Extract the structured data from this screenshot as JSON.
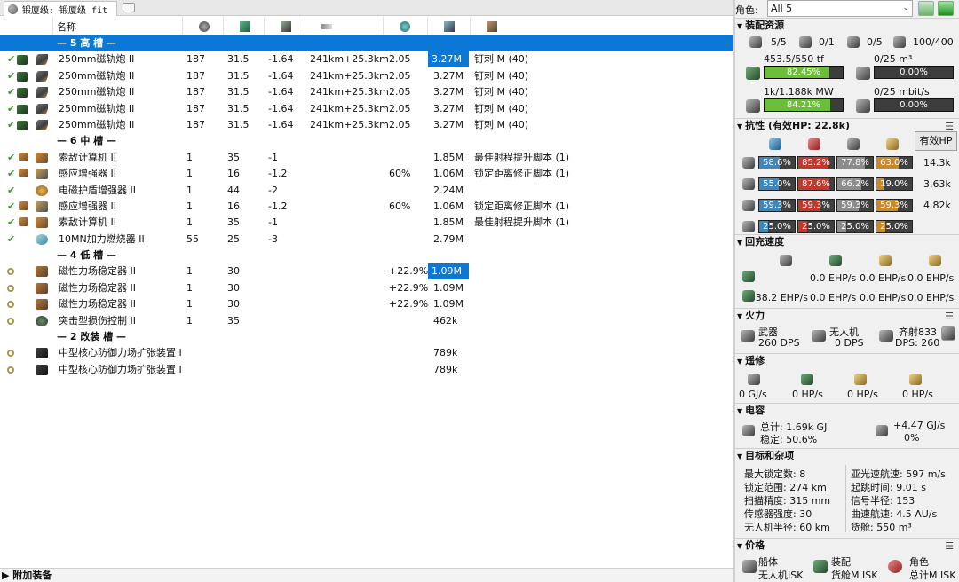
{
  "tab": {
    "title": "锻厦级: 锻厦级 fit"
  },
  "columns": {
    "name": "名称"
  },
  "racks": {
    "high": "— 5 高 槽 —",
    "mid": "— 6 中 槽 —",
    "low": "— 4 低 槽 —",
    "rig": "— 2 改装 槽 —"
  },
  "high_rows": [
    {
      "name": "250mm磁轨炮 II",
      "v1": "187",
      "v2": "31.5",
      "v3": "-1.64",
      "v4": "241km+25.3km",
      "v5": "2.05",
      "v6": "3.27M",
      "ammo": "钉刺 M (40)"
    },
    {
      "name": "250mm磁轨炮 II",
      "v1": "187",
      "v2": "31.5",
      "v3": "-1.64",
      "v4": "241km+25.3km",
      "v5": "2.05",
      "v6": "3.27M",
      "ammo": "钉刺 M (40)"
    },
    {
      "name": "250mm磁轨炮 II",
      "v1": "187",
      "v2": "31.5",
      "v3": "-1.64",
      "v4": "241km+25.3km",
      "v5": "2.05",
      "v6": "3.27M",
      "ammo": "钉刺 M (40)"
    },
    {
      "name": "250mm磁轨炮 II",
      "v1": "187",
      "v2": "31.5",
      "v3": "-1.64",
      "v4": "241km+25.3km",
      "v5": "2.05",
      "v6": "3.27M",
      "ammo": "钉刺 M (40)"
    },
    {
      "name": "250mm磁轨炮 II",
      "v1": "187",
      "v2": "31.5",
      "v3": "-1.64",
      "v4": "241km+25.3km",
      "v5": "2.05",
      "v6": "3.27M",
      "ammo": "钉刺 M (40)"
    }
  ],
  "mid_rows": [
    {
      "name": "索敌计算机 II",
      "v1": "1",
      "v2": "35",
      "v3": "-1",
      "v4": "",
      "v5": "",
      "v6": "1.85M",
      "ammo": "最佳射程提升脚本 (1)"
    },
    {
      "name": "感应增强器 II",
      "v1": "1",
      "v2": "16",
      "v3": "-1.2",
      "v4": "",
      "v5": "60%",
      "v6": "1.06M",
      "ammo": "锁定距离修正脚本 (1)"
    },
    {
      "name": "电磁护盾增强器 II",
      "v1": "1",
      "v2": "44",
      "v3": "-2",
      "v4": "",
      "v5": "",
      "v6": "2.24M",
      "ammo": ""
    },
    {
      "name": "感应增强器 II",
      "v1": "1",
      "v2": "16",
      "v3": "-1.2",
      "v4": "",
      "v5": "60%",
      "v6": "1.06M",
      "ammo": "锁定距离修正脚本 (1)"
    },
    {
      "name": "索敌计算机 II",
      "v1": "1",
      "v2": "35",
      "v3": "-1",
      "v4": "",
      "v5": "",
      "v6": "1.85M",
      "ammo": "最佳射程提升脚本 (1)"
    },
    {
      "name": "10MN加力燃烧器 II",
      "v1": "55",
      "v2": "25",
      "v3": "-3",
      "v4": "",
      "v5": "",
      "v6": "2.79M",
      "ammo": ""
    }
  ],
  "low_rows": [
    {
      "name": "磁性力场稳定器 II",
      "v1": "1",
      "v2": "30",
      "v3": "",
      "v4": "",
      "v5": "+22.9%",
      "v6": "1.09M",
      "ammo": ""
    },
    {
      "name": "磁性力场稳定器 II",
      "v1": "1",
      "v2": "30",
      "v3": "",
      "v4": "",
      "v5": "+22.9%",
      "v6": "1.09M",
      "ammo": ""
    },
    {
      "name": "磁性力场稳定器 II",
      "v1": "1",
      "v2": "30",
      "v3": "",
      "v4": "",
      "v5": "+22.9%",
      "v6": "1.09M",
      "ammo": ""
    },
    {
      "name": "突击型损伤控制 II",
      "v1": "1",
      "v2": "35",
      "v3": "",
      "v4": "",
      "v5": "",
      "v6": "462k",
      "ammo": ""
    }
  ],
  "rig_rows": [
    {
      "name": "中型核心防御力场扩张装置 I",
      "v6": "789k"
    },
    {
      "name": "中型核心防御力场扩张装置 I",
      "v6": "789k"
    }
  ],
  "addon": "附加装备",
  "character": {
    "label": "角色:",
    "value": "All 5"
  },
  "resources": {
    "title": "装配资源",
    "turret": "5/5",
    "launcher": "0/1",
    "drone": "0/5",
    "calib": "100/400",
    "cpu_label": "453.5/550 tf",
    "cpu_pct": "82.45%",
    "cpu_fill": 0.8245,
    "pg_label": "1k/1.188k MW",
    "pg_pct": "84.21%",
    "pg_fill": 0.8421,
    "bay_label": "0/25 m³",
    "bay_pct": "0.00%",
    "bw_label": "0/25 mbit/s",
    "bw_pct": "0.00%"
  },
  "resist": {
    "title": "抗性 (有效HP: 22.8k)",
    "btn": "有效HP",
    "rows": [
      {
        "em": "58.6%",
        "th": "85.2%",
        "ki": "77.8%",
        "ex": "63.0%",
        "hp": "14.3k",
        "emv": 0.586,
        "thv": 0.852,
        "kiv": 0.778,
        "exv": 0.63
      },
      {
        "em": "55.0%",
        "th": "87.6%",
        "ki": "66.2%",
        "ex": "19.0%",
        "hp": "3.63k",
        "emv": 0.55,
        "thv": 0.876,
        "kiv": 0.662,
        "exv": 0.19
      },
      {
        "em": "59.3%",
        "th": "59.3%",
        "ki": "59.3%",
        "ex": "59.3%",
        "hp": "4.82k",
        "emv": 0.593,
        "thv": 0.593,
        "kiv": 0.593,
        "exv": 0.593
      },
      {
        "em": "25.0%",
        "th": "25.0%",
        "ki": "25.0%",
        "ex": "25.0%",
        "hp": "",
        "emv": 0.25,
        "thv": 0.25,
        "kiv": 0.25,
        "exv": 0.25
      }
    ]
  },
  "recharge": {
    "title": "回充速度",
    "r1": [
      "",
      "0.0 EHP/s",
      "0.0 EHP/s",
      "0.0 EHP/s"
    ],
    "r2": [
      "38.2 EHP/s",
      "0.0 EHP/s",
      "0.0 EHP/s",
      "0.0 EHP/s"
    ]
  },
  "firepower": {
    "title": "火力",
    "weapon": "武器",
    "weapon_dps": "260 DPS",
    "drone": "无人机",
    "drone_dps": "0 DPS",
    "volley": "齐射833",
    "volley_dps": "DPS: 260"
  },
  "remote": {
    "title": "遥修",
    "vals": [
      "0 GJ/s",
      "0 HP/s",
      "0 HP/s",
      "0 HP/s"
    ]
  },
  "capacitor": {
    "title": "电容",
    "total": "总计: 1.69k GJ",
    "stable": "稳定: 50.6%",
    "delta": "+4.47 GJ/s",
    "pct": "0%"
  },
  "targeting": {
    "title": "目标和杂项",
    "left": [
      "最大锁定数: 8",
      "锁定范围:    274 km",
      "扫描精度:    315 mm",
      "传感器强度: 30",
      "无人机半径: 60 km"
    ],
    "right": [
      "亚光速航速: 597 m/s",
      "起跳时间:    9.01 s",
      "信号半径:    153",
      "曲速航速:    4.5 AU/s",
      "货舱:          550 m³"
    ]
  },
  "price": {
    "title": "价格",
    "hull": "船体",
    "fit": "装配",
    "char": "角色",
    "drones": "无人机ISK",
    "cargo": "货舱M ISK",
    "total": "总计M ISK"
  }
}
